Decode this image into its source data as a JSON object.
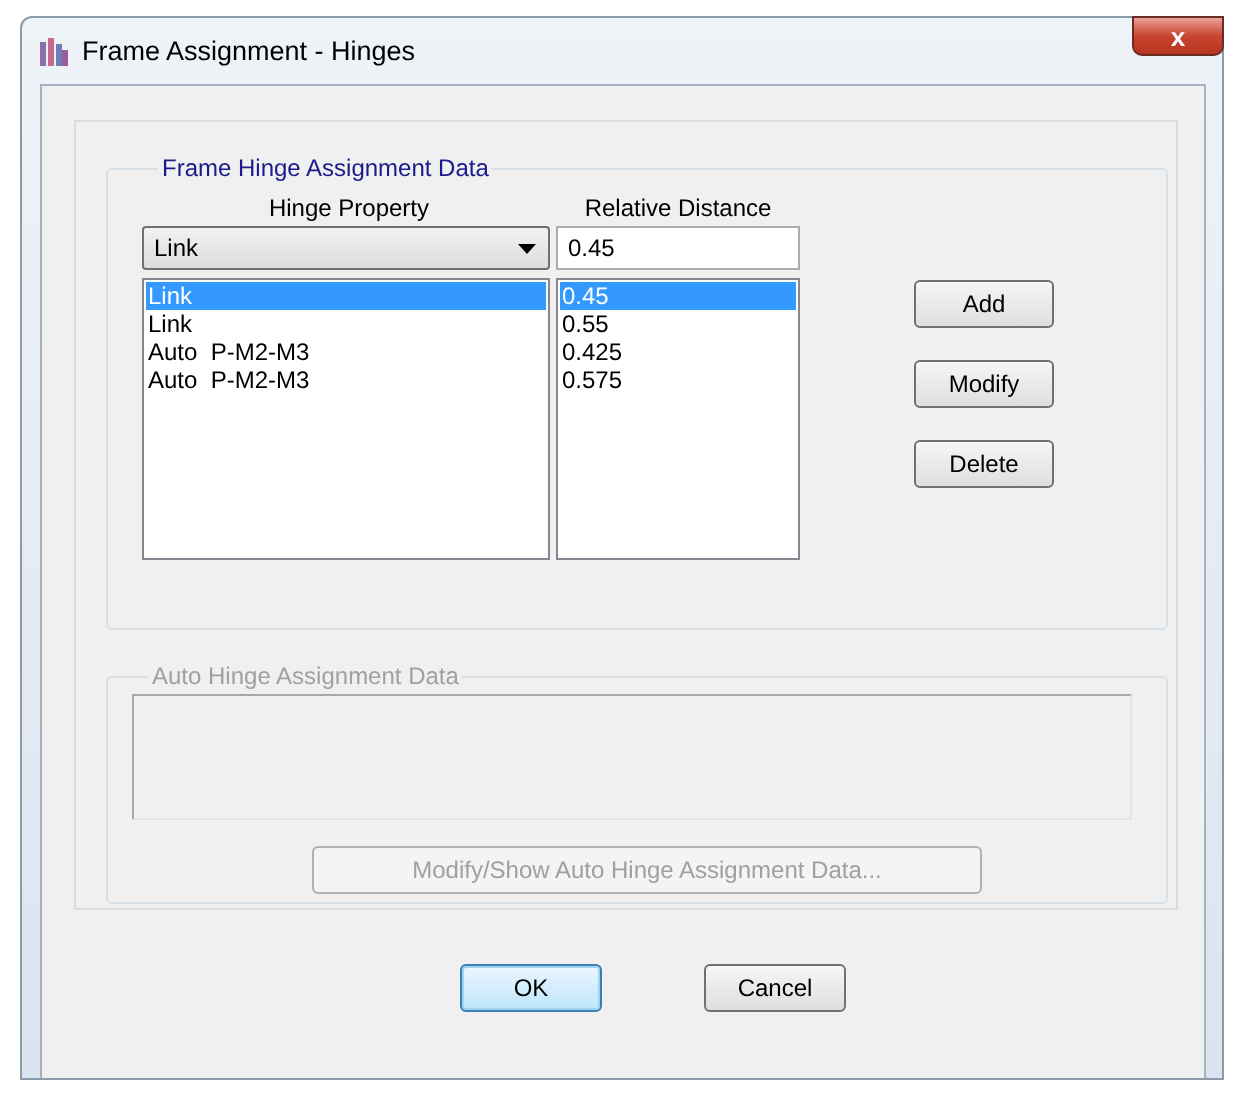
{
  "window": {
    "title": "Frame Assignment - Hinges",
    "close_label": "x"
  },
  "frame_hinge_group": {
    "title": "Frame Hinge Assignment Data",
    "hinge_property_header": "Hinge Property",
    "relative_distance_header": "Relative Distance",
    "hinge_property_combo": "Link",
    "relative_distance_value": "0.45",
    "rows": [
      {
        "hinge_property": "Link",
        "relative_distance": "0.45",
        "selected": true
      },
      {
        "hinge_property": "Link",
        "relative_distance": "0.55",
        "selected": false
      },
      {
        "hinge_property": "Auto  P-M2-M3",
        "relative_distance": "0.425",
        "selected": false
      },
      {
        "hinge_property": "Auto  P-M2-M3",
        "relative_distance": "0.575",
        "selected": false
      }
    ],
    "buttons": [
      "Add",
      "Modify",
      "Delete"
    ]
  },
  "auto_hinge_group": {
    "title": "Auto Hinge Assignment Data",
    "disabled": true,
    "button": "Modify/Show Auto Hinge Assignment Data..."
  },
  "buttons": [
    {
      "label": "OK",
      "default": true
    },
    {
      "label": "Cancel",
      "default": false
    }
  ]
}
